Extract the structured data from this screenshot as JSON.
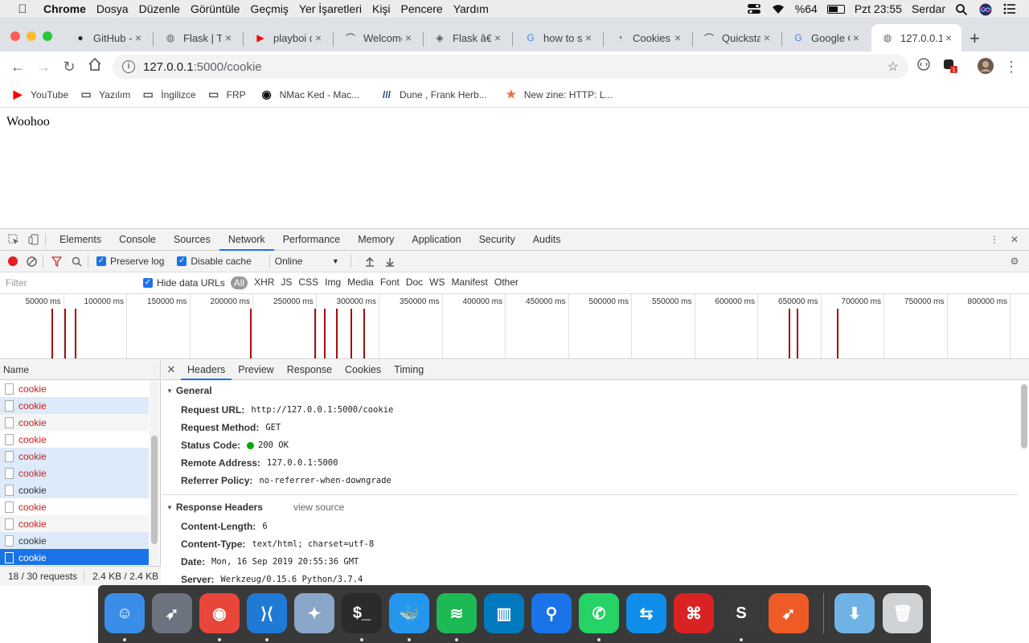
{
  "menubar": {
    "app": "Chrome",
    "items": [
      "Dosya",
      "Düzenle",
      "Görüntüle",
      "Geçmiş",
      "Yer İşaretleri",
      "Kişi",
      "Pencere",
      "Yardım"
    ],
    "battery": "%64",
    "battery_level": 0.64,
    "clock": "Pzt 23:55",
    "user": "Serdar"
  },
  "tabs": [
    {
      "title": "GitHub -",
      "icon": "github-icon"
    },
    {
      "title": "Flask | T",
      "icon": "globe-icon"
    },
    {
      "title": "playboi c",
      "icon": "youtube-icon"
    },
    {
      "title": "Welcome",
      "icon": "flask-icon"
    },
    {
      "title": "Flask â€",
      "icon": "diamond-icon"
    },
    {
      "title": "how to s",
      "icon": "google-icon"
    },
    {
      "title": "Cookies",
      "icon": "bulb-icon"
    },
    {
      "title": "Quicksta",
      "icon": "flask-icon"
    },
    {
      "title": "Google C",
      "icon": "translate-icon"
    },
    {
      "title": "127.0.0.1",
      "icon": "globe-icon",
      "active": true
    }
  ],
  "omnibox": {
    "host": "127.0.0.1",
    "path": ":5000/cookie"
  },
  "bookmarks": [
    {
      "label": "YouTube",
      "icon": "youtube-icon"
    },
    {
      "label": "Yazılım",
      "icon": "folder-icon"
    },
    {
      "label": "İngilizce",
      "icon": "folder-icon"
    },
    {
      "label": "FRP",
      "icon": "folder-icon"
    },
    {
      "label": "NMac Ked - Mac...",
      "icon": "nmac-icon"
    },
    {
      "label": "Dune , Frank Herb...",
      "icon": "stripes-icon"
    },
    {
      "label": "New zine: HTTP: L...",
      "icon": "star-icon"
    }
  ],
  "page": {
    "text": "Woohoo"
  },
  "devtools": {
    "tabs": [
      "Elements",
      "Console",
      "Sources",
      "Network",
      "Performance",
      "Memory",
      "Application",
      "Security",
      "Audits"
    ],
    "active_tab": "Network",
    "preserve_log": "Preserve log",
    "disable_cache": "Disable cache",
    "throttle": "Online",
    "filter_placeholder": "Filter",
    "hide_data_urls": "Hide data URLs",
    "types": [
      "All",
      "XHR",
      "JS",
      "CSS",
      "Img",
      "Media",
      "Font",
      "Doc",
      "WS",
      "Manifest",
      "Other"
    ],
    "overview_ticks": [
      "50000 ms",
      "100000 ms",
      "150000 ms",
      "200000 ms",
      "250000 ms",
      "300000 ms",
      "350000 ms",
      "400000 ms",
      "450000 ms",
      "500000 ms",
      "550000 ms",
      "600000 ms",
      "650000 ms",
      "700000 ms",
      "750000 ms",
      "800000 ms"
    ],
    "overview_requests_ms": [
      41000,
      51000,
      59000,
      198000,
      249000,
      257000,
      266000,
      278000,
      288000,
      625000,
      631000,
      663000
    ],
    "name_header": "Name",
    "requests": [
      {
        "name": "cookie",
        "red": true,
        "style": "odd"
      },
      {
        "name": "cookie",
        "red": true,
        "style": "hl"
      },
      {
        "name": "cookie",
        "red": true,
        "style": "even"
      },
      {
        "name": "cookie",
        "red": true,
        "style": "odd"
      },
      {
        "name": "cookie",
        "red": true,
        "style": "hl"
      },
      {
        "name": "cookie",
        "red": true,
        "style": "hl"
      },
      {
        "name": "cookie",
        "red": false,
        "style": "hl"
      },
      {
        "name": "cookie",
        "red": true,
        "style": "odd"
      },
      {
        "name": "cookie",
        "red": true,
        "style": "even"
      },
      {
        "name": "cookie",
        "red": false,
        "style": "hl"
      },
      {
        "name": "cookie",
        "red": false,
        "style": "sel"
      }
    ],
    "summary_requests": "18 / 30 requests",
    "summary_size": "2.4 KB / 2.4 KB",
    "detail_tabs": [
      "Headers",
      "Preview",
      "Response",
      "Cookies",
      "Timing"
    ],
    "general_title": "General",
    "general": [
      {
        "k": "Request URL:",
        "v": "http://127.0.0.1:5000/cookie"
      },
      {
        "k": "Request Method:",
        "v": "GET"
      },
      {
        "k": "Status Code:",
        "v": "200 OK",
        "dot": true
      },
      {
        "k": "Remote Address:",
        "v": "127.0.0.1:5000"
      },
      {
        "k": "Referrer Policy:",
        "v": "no-referrer-when-downgrade"
      }
    ],
    "response_title": "Response Headers",
    "view_source": "view source",
    "response": [
      {
        "k": "Content-Length:",
        "v": "6"
      },
      {
        "k": "Content-Type:",
        "v": "text/html; charset=utf-8"
      },
      {
        "k": "Date:",
        "v": "Mon, 16 Sep 2019 20:55:36 GMT"
      },
      {
        "k": "Server:",
        "v": "Werkzeug/0.15.6 Python/3.7.4"
      }
    ]
  },
  "dock": [
    {
      "name": "finder-icon",
      "color": "#3b8ee8",
      "running": true
    },
    {
      "name": "launchpad-icon",
      "color": "#6d7480",
      "running": false
    },
    {
      "name": "chrome-icon",
      "color": "#e8463b",
      "running": true
    },
    {
      "name": "vscode-icon",
      "color": "#1f7ad6",
      "running": true
    },
    {
      "name": "preview-icon",
      "color": "#8aa6c8",
      "running": false
    },
    {
      "name": "terminal-icon",
      "color": "#2b2b2b",
      "running": true
    },
    {
      "name": "docker-icon",
      "color": "#2496ed",
      "running": true
    },
    {
      "name": "spotify-icon",
      "color": "#1db954",
      "running": true
    },
    {
      "name": "trello-icon",
      "color": "#0079bf",
      "running": false
    },
    {
      "name": "maps-pin-icon",
      "color": "#1a73e8",
      "running": false
    },
    {
      "name": "whatsapp-icon",
      "color": "#25d366",
      "running": true
    },
    {
      "name": "teamviewer-icon",
      "color": "#0e8ee9",
      "running": false
    },
    {
      "name": "acrobat-icon",
      "color": "#d92323",
      "running": false
    },
    {
      "name": "sublime-icon",
      "color": "#3a3a3a",
      "running": true
    },
    {
      "name": "postman-icon",
      "color": "#ef5b25",
      "running": false
    },
    {
      "name": "downloads-folder-icon",
      "color": "#6fb3e6",
      "running": false
    },
    {
      "name": "trash-icon",
      "color": "#cfd3d6",
      "running": false
    }
  ]
}
